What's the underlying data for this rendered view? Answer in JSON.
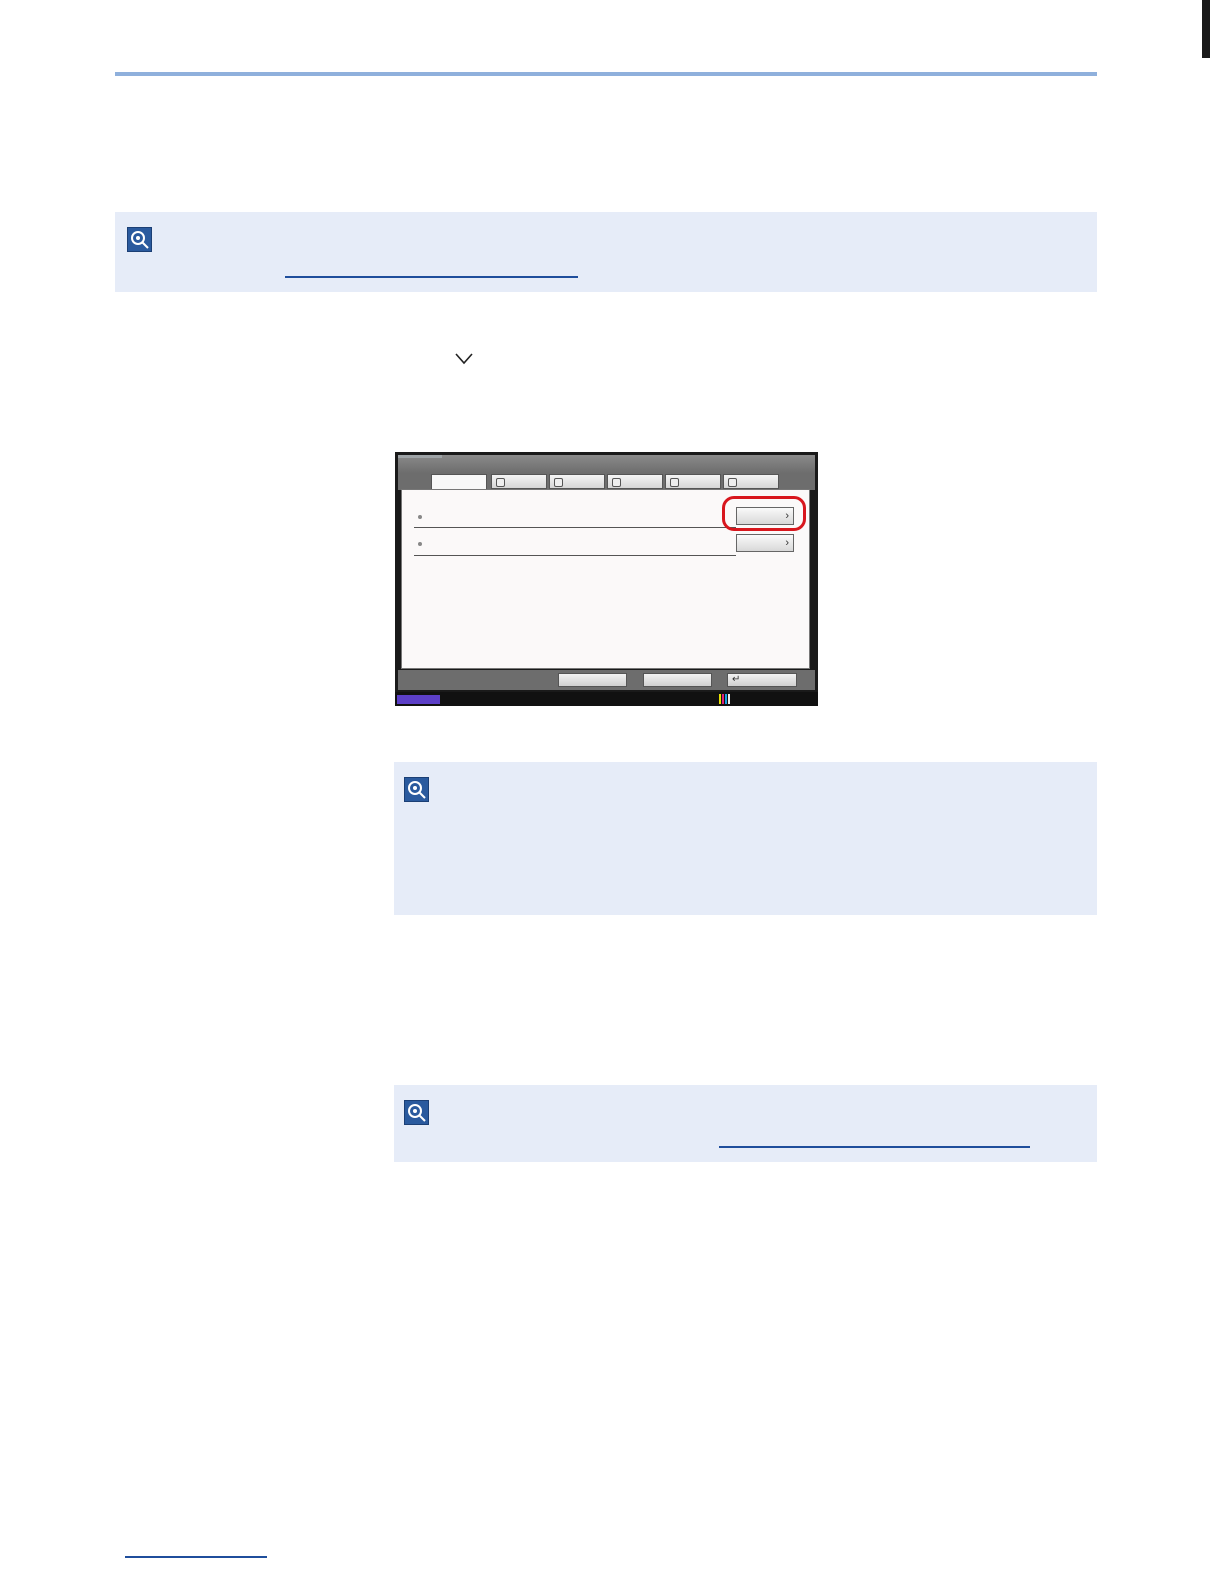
{
  "icons": {
    "note": "note-lightbulb-icon",
    "chevron": "chevron-down-icon",
    "row_arrow": "chevron-right-icon",
    "enter": "enter-arrow-icon"
  },
  "panel": {
    "buttons": {
      "row1_label": "›",
      "row2_label": "›",
      "footer3_label": "↵"
    }
  },
  "colors": {
    "accent_rule": "#8fb0dc",
    "note_background": "#e6ecf8",
    "highlight": "#d8161d",
    "link": "#1f4e9c"
  }
}
